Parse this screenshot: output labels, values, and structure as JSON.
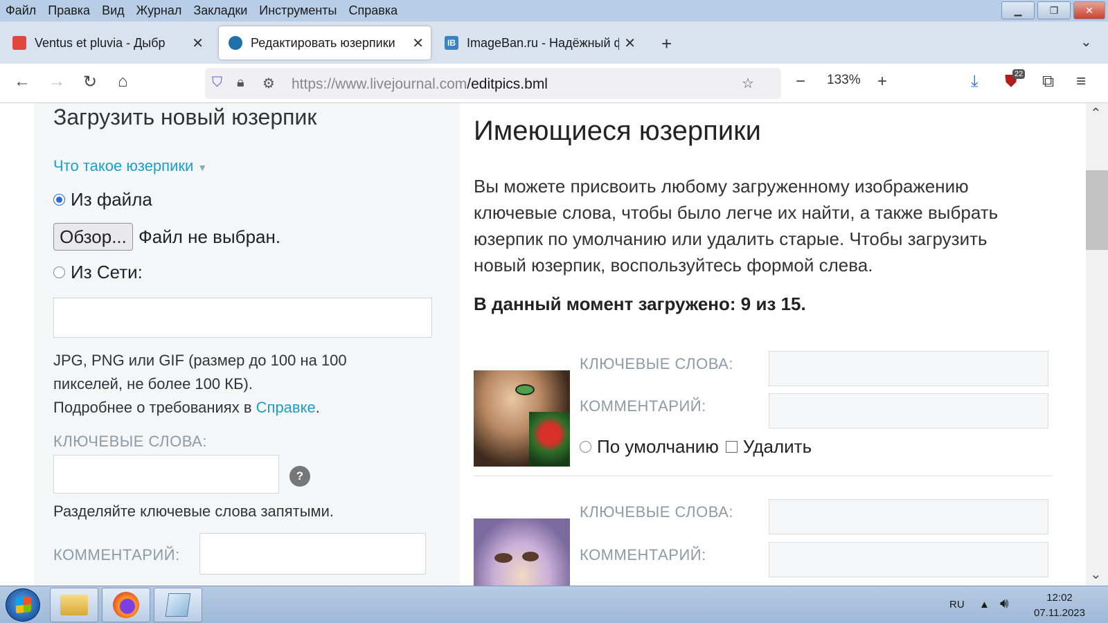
{
  "menubar": {
    "items": [
      "Файл",
      "Правка",
      "Вид",
      "Журнал",
      "Закладки",
      "Инструменты",
      "Справка"
    ]
  },
  "tabs": [
    {
      "label": "Ventus et pluvia - Дыбр",
      "favicon_color": "#e0483f"
    },
    {
      "label": "Редактировать юзерпики",
      "favicon_color": "#1f6fa8"
    },
    {
      "label": "ImageBan.ru - Надёжный ф",
      "favicon_color": "#3b82c4"
    }
  ],
  "navbar": {
    "url_host": "https://www.livejournal.com",
    "url_path": "/editpics.bml",
    "zoom": "133%",
    "extension_badge": "22"
  },
  "left": {
    "title": "Загрузить новый юзерпик",
    "what_is": "Что такое юзерпики",
    "from_file": "Из файла",
    "browse_button": "Обзор...",
    "file_status": "Файл не выбран.",
    "from_web": "Из Сети:",
    "format_hint_1": "JPG, PNG или GIF (размер до 100 на 100",
    "format_hint_2": "пикселей, не более 100 КБ).",
    "more_info_prefix": "Подробнее о требованиях в ",
    "more_info_link": "Справке",
    "more_info_suffix": ".",
    "keywords_label": "КЛЮЧЕВЫЕ СЛОВА:",
    "help": "?",
    "keywords_hint": "Разделяйте ключевые слова запятыми.",
    "comment_label": "КОММЕНТАРИЙ:"
  },
  "right": {
    "title": "Имеющиеся юзерпики",
    "description": "Вы можете присвоить любому загруженному изображению ключевые слова, чтобы было легче их найти, а также выбрать юзерпик по умолчанию или удалить старые. Чтобы загрузить новый юзерпик, воспользуйтесь формой слева.",
    "count": "В данный момент загружено: 9 из 15.",
    "userpics": [
      {
        "keywords_label": "КЛЮЧЕВЫЕ СЛОВА:",
        "comment_label": "КОММЕНТАРИЙ:",
        "default_label": "По умолчанию",
        "delete_label": "Удалить"
      },
      {
        "keywords_label": "КЛЮЧЕВЫЕ СЛОВА:",
        "comment_label": "КОММЕНТАРИЙ:"
      }
    ]
  },
  "taskbar": {
    "lang": "RU",
    "time": "12:02",
    "date": "07.11.2023"
  },
  "colors": {
    "accent_link": "#1aa0c9",
    "titlebar": "#b8cde6"
  }
}
